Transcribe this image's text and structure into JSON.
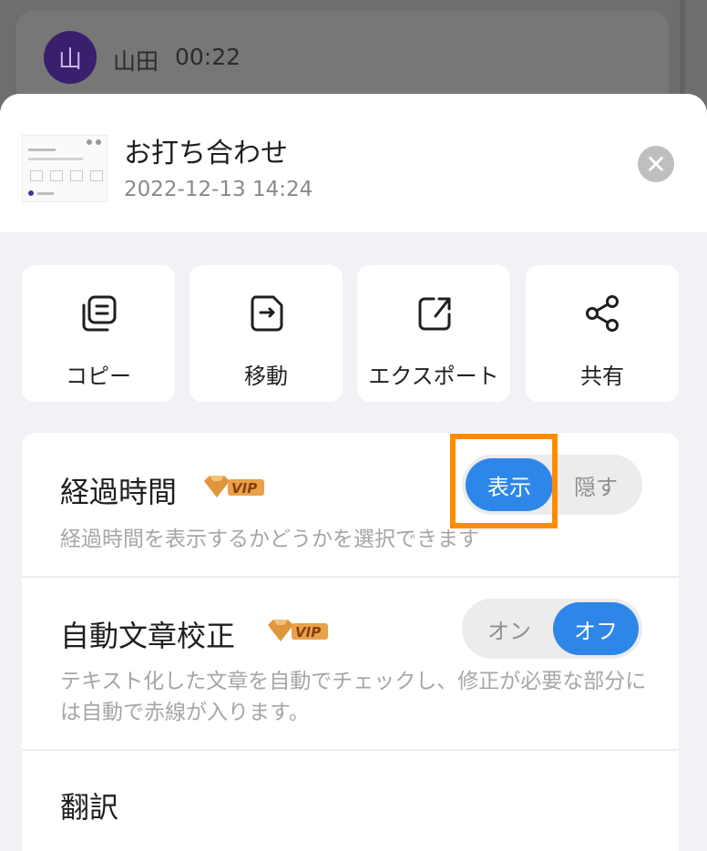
{
  "background": {
    "avatar_char": "山",
    "user_name": "山田",
    "time": "00:22"
  },
  "sheet": {
    "recording_title": "お打ち合わせ",
    "recording_date": "2022-12-13 14:24",
    "close_icon": "close-icon",
    "thumbnail_title": "お打ち合わせ"
  },
  "actions": [
    {
      "label": "コピー",
      "icon": "copy-icon"
    },
    {
      "label": "移動",
      "icon": "move-icon"
    },
    {
      "label": "エクスポート",
      "icon": "export-icon"
    },
    {
      "label": "共有",
      "icon": "share-icon"
    }
  ],
  "settings": {
    "elapsed_time": {
      "title": "経過時間",
      "badge": "VIP",
      "description": "経過時間を表示するかどうかを選択できます",
      "options": [
        "表示",
        "隠す"
      ],
      "selected": "表示"
    },
    "auto_proofread": {
      "title": "自動文章校正",
      "badge": "VIP",
      "description": "テキスト化した文章を自動でチェックし、修正が必要な部分には自動で赤線が入ります。",
      "options": [
        "オン",
        "オフ"
      ],
      "selected": "オフ"
    },
    "translate": {
      "title": "翻訳"
    }
  },
  "colors": {
    "accent": "#2f86e9",
    "highlight": "#ff8c00",
    "vip_gold": "#d98e2c"
  }
}
